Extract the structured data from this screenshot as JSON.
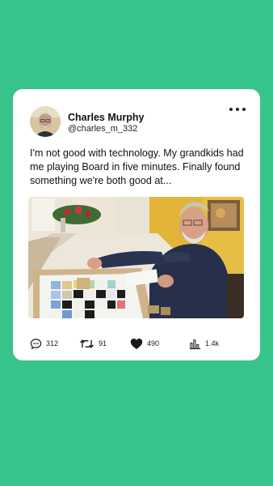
{
  "post": {
    "author_name": "Charles Murphy",
    "author_handle": "@charles_m_332",
    "text": "I'm not good with technology. My grandkids had me playing Board in five minutes. Finally found something we're both good at..."
  },
  "actions": {
    "replies": "312",
    "reposts": "91",
    "likes": "490",
    "views": "1.4k"
  },
  "icons": {
    "more": "more-horizontal-icon",
    "reply": "comment-bubble-icon",
    "repost": "repost-arrows-icon",
    "like": "heart-icon",
    "views": "bar-chart-icon"
  },
  "colors": {
    "background": "#36c48b",
    "card": "#ffffff",
    "text": "#111111"
  }
}
